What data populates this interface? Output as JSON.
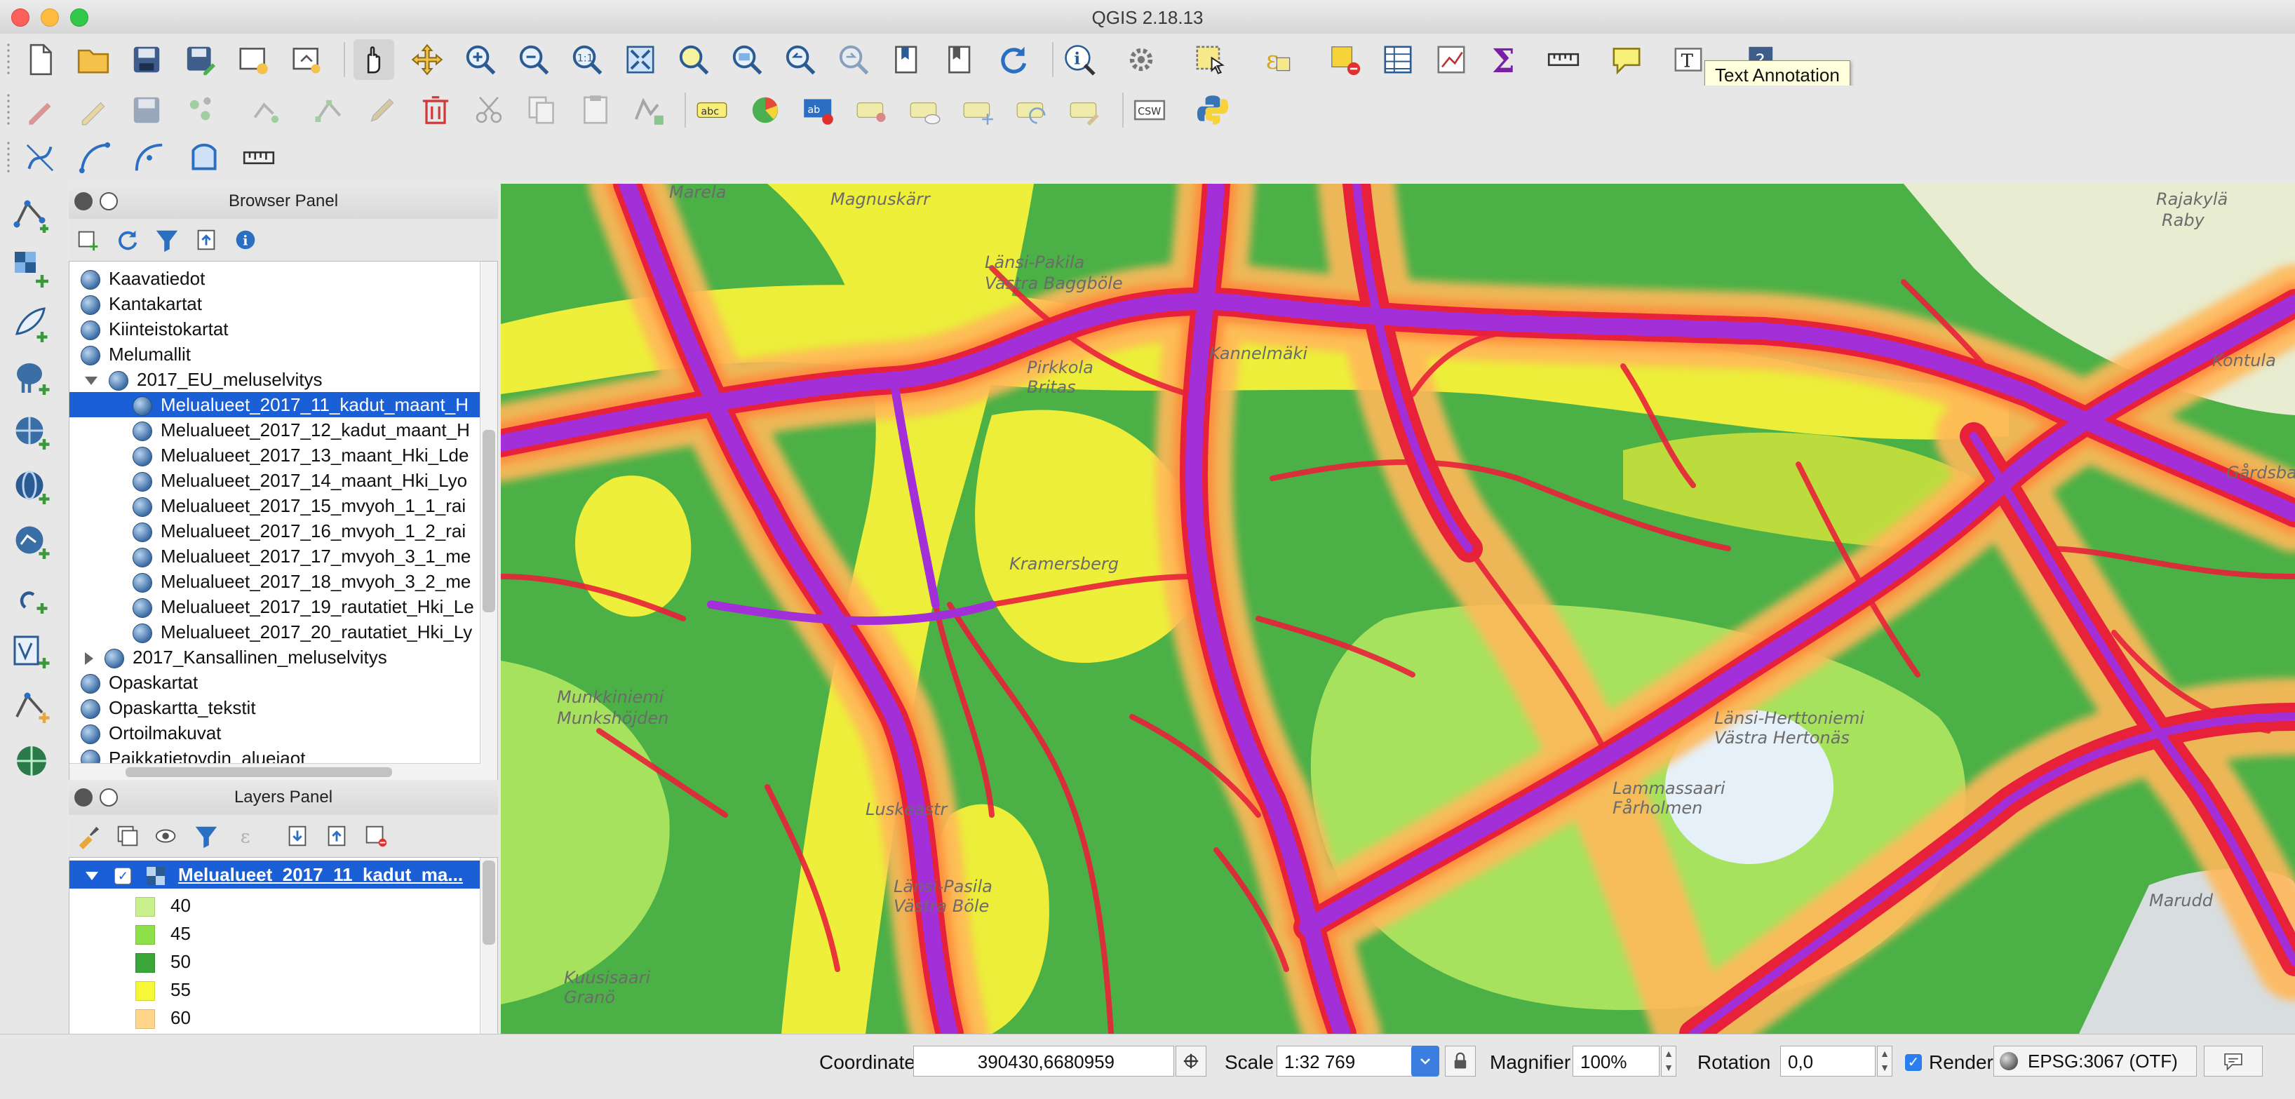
{
  "window": {
    "title": "QGIS 2.18.13"
  },
  "tooltip": {
    "text": "Text Annotation"
  },
  "browser_panel": {
    "title": "Browser Panel",
    "items": [
      {
        "label": "Kaavatiedot",
        "level": 0
      },
      {
        "label": "Kantakartat",
        "level": 0
      },
      {
        "label": "Kiinteistokartat",
        "level": 0
      },
      {
        "label": "Melumallit",
        "level": 0
      },
      {
        "label": "2017_EU_meluselvitys",
        "level": 1
      },
      {
        "label": "Melualueet_2017_11_kadut_maant_H",
        "level": 2
      },
      {
        "label": "Melualueet_2017_12_kadut_maant_H",
        "level": 2
      },
      {
        "label": "Melualueet_2017_13_maant_Hki_Lde",
        "level": 2
      },
      {
        "label": "Melualueet_2017_14_maant_Hki_Lyo",
        "level": 2
      },
      {
        "label": "Melualueet_2017_15_mvyoh_1_1_rai",
        "level": 2
      },
      {
        "label": "Melualueet_2017_16_mvyoh_1_2_rai",
        "level": 2
      },
      {
        "label": "Melualueet_2017_17_mvyoh_3_1_me",
        "level": 2
      },
      {
        "label": "Melualueet_2017_18_mvyoh_3_2_me",
        "level": 2
      },
      {
        "label": "Melualueet_2017_19_rautatiet_Hki_Le",
        "level": 2
      },
      {
        "label": "Melualueet_2017_20_rautatiet_Hki_Ly",
        "level": 2
      },
      {
        "label": "2017_Kansallinen_meluselvitys",
        "level": 1
      },
      {
        "label": "Opaskartat",
        "level": 0
      },
      {
        "label": "Opaskartta_tekstit",
        "level": 0
      },
      {
        "label": "Ortoilmakuvat",
        "level": 0
      },
      {
        "label": "Paikkatietovdin_alueiaot",
        "level": 0
      }
    ]
  },
  "layers_panel": {
    "title": "Layers Panel",
    "layer_name": "Melualueet_2017_11_kadut_ma...",
    "legend": [
      {
        "label": "40",
        "color": "#c8f08c"
      },
      {
        "label": "45",
        "color": "#8ee04a"
      },
      {
        "label": "50",
        "color": "#3aa63a"
      },
      {
        "label": "55",
        "color": "#f7f73a"
      },
      {
        "label": "60",
        "color": "#ffd68a"
      },
      {
        "label": "",
        "color": "#ffa040"
      }
    ]
  },
  "map": {
    "labels": [
      "Rajakylä",
      "Raby",
      "Marela",
      "Magnuskärr",
      "Länsi-Pakila",
      "Västra Baggböle",
      "Pirkkola",
      "Britas",
      "Kannelmäki",
      "Kramersberg",
      "Munkkiniemi",
      "Munkshöjden",
      "Luskeastr",
      "Länsi-Pasila",
      "Västra Böle",
      "Kuusisaari",
      "Granö",
      "Länsi-Herttoniemi",
      "Västra Hertonäs",
      "Lammassaari",
      "Fårholmen",
      "Marudd",
      "Kontula",
      "Gårdsbacka"
    ]
  },
  "statusbar": {
    "coordinate_label": "Coordinate",
    "coordinate_value": "390430,6680959",
    "scale_label": "Scale",
    "scale_value": "1:32 769",
    "magnifier_label": "Magnifier",
    "magnifier_value": "100%",
    "rotation_label": "Rotation",
    "rotation_value": "0,0",
    "render_label": "Render",
    "crs_label": "EPSG:3067 (OTF)"
  },
  "colors": {
    "noise_40": "#c8f08c",
    "noise_45": "#8ee04a",
    "noise_50": "#3aa63a",
    "noise_55": "#f7f73a",
    "noise_60": "#ffc466",
    "noise_65": "#ff8a3a",
    "noise_70": "#e8213a",
    "noise_75": "#a22fd8",
    "selection": "#1b5fd6"
  }
}
